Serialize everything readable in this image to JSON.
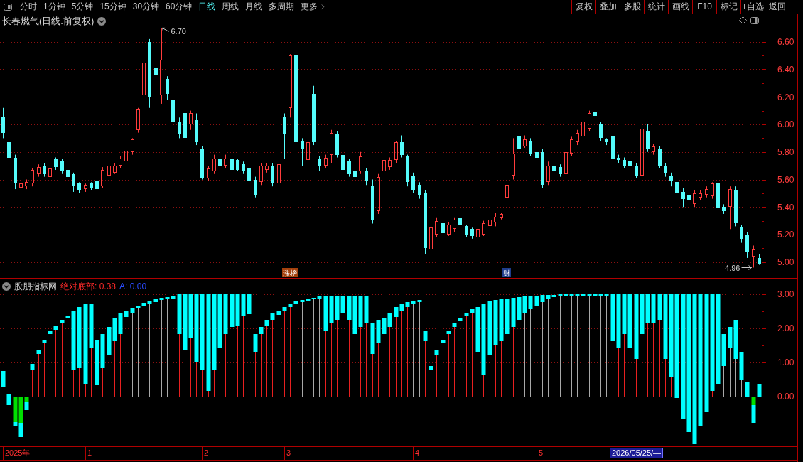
{
  "toolbar": {
    "tabs": [
      {
        "label": "分时",
        "selected": false
      },
      {
        "label": "1分钟",
        "selected": false
      },
      {
        "label": "5分钟",
        "selected": false
      },
      {
        "label": "15分钟",
        "selected": false
      },
      {
        "label": "30分钟",
        "selected": false
      },
      {
        "label": "60分钟",
        "selected": false
      },
      {
        "label": "日线",
        "selected": true
      },
      {
        "label": "周线",
        "selected": false
      },
      {
        "label": "月线",
        "selected": false
      },
      {
        "label": "多周期",
        "selected": false
      }
    ],
    "more": {
      "label": "更多"
    },
    "actions": [
      "复权",
      "叠加",
      "多股",
      "统计",
      "画线",
      "F10",
      "标记",
      "+自选",
      "返回"
    ]
  },
  "price_panel": {
    "title": "长春燃气(日线.前复权)",
    "high_mark": "6.70",
    "low_mark": "4.96",
    "events": [
      {
        "label": "涨榜",
        "kind": "rank"
      },
      {
        "label": "财",
        "kind": "finance"
      }
    ],
    "chart_data": [
      {
        "type": "candlestick",
        "ylim": [
          4.88,
          6.8
        ],
        "yticks": [
          {
            "value": 5.0,
            "label": "5.00"
          },
          {
            "value": 5.2,
            "label": "5.20"
          },
          {
            "value": 5.4,
            "label": "5.40"
          },
          {
            "value": 5.6,
            "label": "5.60"
          },
          {
            "value": 5.8,
            "label": "5.80"
          },
          {
            "value": 6.0,
            "label": "6.00"
          },
          {
            "value": 6.2,
            "label": "6.20"
          },
          {
            "value": 6.4,
            "label": "6.40"
          },
          {
            "value": 6.6,
            "label": "6.60"
          }
        ],
        "grid": true,
        "ohlc": [
          [
            6.05,
            6.12,
            5.9,
            5.94
          ],
          [
            5.87,
            5.9,
            5.74,
            5.76
          ],
          [
            5.76,
            5.78,
            5.53,
            5.57
          ],
          [
            5.54,
            5.6,
            5.5,
            5.57
          ],
          [
            5.55,
            5.6,
            5.53,
            5.58
          ],
          [
            5.57,
            5.68,
            5.55,
            5.67
          ],
          [
            5.64,
            5.71,
            5.62,
            5.69
          ],
          [
            5.7,
            5.72,
            5.62,
            5.64
          ],
          [
            5.62,
            5.7,
            5.61,
            5.68
          ],
          [
            5.75,
            5.76,
            5.67,
            5.69
          ],
          [
            5.73,
            5.75,
            5.64,
            5.66
          ],
          [
            5.67,
            5.68,
            5.6,
            5.62
          ],
          [
            5.64,
            5.65,
            5.51,
            5.55
          ],
          [
            5.57,
            5.58,
            5.5,
            5.52
          ],
          [
            5.53,
            5.57,
            5.51,
            5.56
          ],
          [
            5.57,
            5.58,
            5.52,
            5.54
          ],
          [
            5.59,
            5.61,
            5.5,
            5.53
          ],
          [
            5.55,
            5.69,
            5.54,
            5.67
          ],
          [
            5.63,
            5.71,
            5.62,
            5.7
          ],
          [
            5.65,
            5.72,
            5.64,
            5.7
          ],
          [
            5.7,
            5.77,
            5.68,
            5.75
          ],
          [
            5.73,
            5.82,
            5.71,
            5.81
          ],
          [
            5.8,
            5.9,
            5.78,
            5.89
          ],
          [
            5.96,
            6.12,
            5.94,
            6.11
          ],
          [
            6.21,
            6.47,
            6.18,
            6.45
          ],
          [
            6.6,
            6.62,
            6.12,
            6.2
          ],
          [
            6.41,
            6.43,
            6.33,
            6.36
          ],
          [
            6.21,
            6.7,
            6.15,
            6.47
          ],
          [
            6.33,
            6.35,
            6.18,
            6.22
          ],
          [
            6.18,
            6.2,
            6.0,
            6.02
          ],
          [
            6.02,
            6.05,
            5.9,
            5.93
          ],
          [
            6.08,
            6.1,
            5.88,
            5.9
          ],
          [
            6.0,
            6.1,
            5.96,
            6.08
          ],
          [
            6.03,
            6.08,
            5.85,
            5.87
          ],
          [
            5.82,
            5.84,
            5.6,
            5.61
          ],
          [
            5.61,
            5.7,
            5.59,
            5.68
          ],
          [
            5.66,
            5.78,
            5.64,
            5.75
          ],
          [
            5.75,
            5.76,
            5.68,
            5.7
          ],
          [
            5.7,
            5.78,
            5.68,
            5.75
          ],
          [
            5.75,
            5.76,
            5.65,
            5.67
          ],
          [
            5.74,
            5.75,
            5.66,
            5.67
          ],
          [
            5.71,
            5.73,
            5.64,
            5.66
          ],
          [
            5.68,
            5.7,
            5.57,
            5.59
          ],
          [
            5.6,
            5.62,
            5.47,
            5.49
          ],
          [
            5.58,
            5.72,
            5.56,
            5.7
          ],
          [
            5.67,
            5.72,
            5.65,
            5.7
          ],
          [
            5.7,
            5.72,
            5.55,
            5.57
          ],
          [
            5.57,
            5.73,
            5.56,
            5.71
          ],
          [
            6.05,
            6.08,
            5.75,
            5.93
          ],
          [
            6.12,
            6.51,
            6.05,
            6.5
          ],
          [
            6.5,
            6.51,
            5.85,
            5.87
          ],
          [
            5.88,
            5.9,
            5.7,
            5.82
          ],
          [
            5.74,
            5.88,
            5.62,
            5.87
          ],
          [
            6.22,
            6.28,
            5.85,
            5.87
          ],
          [
            5.75,
            5.77,
            5.66,
            5.7
          ],
          [
            5.7,
            5.78,
            5.68,
            5.76
          ],
          [
            5.78,
            5.96,
            5.72,
            5.94
          ],
          [
            5.93,
            5.95,
            5.76,
            5.78
          ],
          [
            5.78,
            5.8,
            5.65,
            5.67
          ],
          [
            5.73,
            5.75,
            5.62,
            5.64
          ],
          [
            5.66,
            5.68,
            5.58,
            5.62
          ],
          [
            5.66,
            5.8,
            5.64,
            5.77
          ],
          [
            5.66,
            5.68,
            5.56,
            5.59
          ],
          [
            5.55,
            5.6,
            5.28,
            5.31
          ],
          [
            5.37,
            5.64,
            5.35,
            5.62
          ],
          [
            5.66,
            5.76,
            5.55,
            5.74
          ],
          [
            5.69,
            5.76,
            5.67,
            5.74
          ],
          [
            5.74,
            5.88,
            5.72,
            5.87
          ],
          [
            5.87,
            5.92,
            5.76,
            5.78
          ],
          [
            5.77,
            5.78,
            5.55,
            5.58
          ],
          [
            5.63,
            5.65,
            5.5,
            5.52
          ],
          [
            5.56,
            5.58,
            5.46,
            5.49
          ],
          [
            5.5,
            5.52,
            5.06,
            5.1
          ],
          [
            5.09,
            5.28,
            5.03,
            5.25
          ],
          [
            5.2,
            5.32,
            5.18,
            5.3
          ],
          [
            5.28,
            5.3,
            5.19,
            5.21
          ],
          [
            5.2,
            5.29,
            5.19,
            5.27
          ],
          [
            5.24,
            5.32,
            5.22,
            5.31
          ],
          [
            5.32,
            5.34,
            5.25,
            5.27
          ],
          [
            5.26,
            5.27,
            5.18,
            5.2
          ],
          [
            5.24,
            5.25,
            5.17,
            5.19
          ],
          [
            5.18,
            5.26,
            5.17,
            5.24
          ],
          [
            5.2,
            5.3,
            5.19,
            5.28
          ],
          [
            5.26,
            5.33,
            5.25,
            5.31
          ],
          [
            5.29,
            5.36,
            5.26,
            5.33
          ],
          [
            5.32,
            5.36,
            5.31,
            5.35
          ],
          [
            5.47,
            5.58,
            5.46,
            5.56
          ],
          [
            5.63,
            5.9,
            5.6,
            5.79
          ],
          [
            5.91,
            5.93,
            5.8,
            5.82
          ],
          [
            5.84,
            5.92,
            5.83,
            5.89
          ],
          [
            5.88,
            5.9,
            5.77,
            5.79
          ],
          [
            5.8,
            5.82,
            5.74,
            5.76
          ],
          [
            5.8,
            5.82,
            5.54,
            5.56
          ],
          [
            5.58,
            5.73,
            5.56,
            5.7
          ],
          [
            5.7,
            5.72,
            5.65,
            5.66
          ],
          [
            5.69,
            5.71,
            5.62,
            5.64
          ],
          [
            5.64,
            5.82,
            5.63,
            5.8
          ],
          [
            5.79,
            5.91,
            5.77,
            5.89
          ],
          [
            5.87,
            5.96,
            5.85,
            5.94
          ],
          [
            5.91,
            6.04,
            5.89,
            6.02
          ],
          [
            5.97,
            6.1,
            5.95,
            6.08
          ],
          [
            6.09,
            6.32,
            6.04,
            6.06
          ],
          [
            6.0,
            6.02,
            5.88,
            5.9
          ],
          [
            5.89,
            5.9,
            5.85,
            5.87
          ],
          [
            5.91,
            5.93,
            5.72,
            5.75
          ],
          [
            5.76,
            5.78,
            5.72,
            5.74
          ],
          [
            5.74,
            5.76,
            5.68,
            5.7
          ],
          [
            5.73,
            5.75,
            5.68,
            5.7
          ],
          [
            5.7,
            5.72,
            5.61,
            5.63
          ],
          [
            5.63,
            6.02,
            5.6,
            5.97
          ],
          [
            5.95,
            6.0,
            5.8,
            5.82
          ],
          [
            5.8,
            5.86,
            5.78,
            5.84
          ],
          [
            5.82,
            5.84,
            5.68,
            5.7
          ],
          [
            5.7,
            5.72,
            5.62,
            5.65
          ],
          [
            5.63,
            5.65,
            5.55,
            5.59
          ],
          [
            5.58,
            5.6,
            5.46,
            5.5
          ],
          [
            5.51,
            5.54,
            5.4,
            5.46
          ],
          [
            5.49,
            5.52,
            5.4,
            5.45
          ],
          [
            5.42,
            5.52,
            5.4,
            5.5
          ],
          [
            5.47,
            5.52,
            5.45,
            5.5
          ],
          [
            5.49,
            5.55,
            5.47,
            5.53
          ],
          [
            5.48,
            5.58,
            5.46,
            5.57
          ],
          [
            5.57,
            5.6,
            5.37,
            5.39
          ],
          [
            5.4,
            5.42,
            5.35,
            5.37
          ],
          [
            5.4,
            5.55,
            5.24,
            5.53
          ],
          [
            5.52,
            5.55,
            5.26,
            5.28
          ],
          [
            5.25,
            5.27,
            5.14,
            5.17
          ],
          [
            5.2,
            5.22,
            5.03,
            5.07
          ],
          [
            5.04,
            5.12,
            4.96,
            5.09
          ],
          [
            5.03,
            5.06,
            4.98,
            4.99
          ]
        ]
      }
    ]
  },
  "indicator_panel": {
    "title": "股朋指标网",
    "readings": [
      {
        "label": "绝对底部: 0.38",
        "color": "#ff2a2a"
      },
      {
        "label": "A: 0.00",
        "color": "#2a4bff"
      }
    ],
    "chart_data": [
      {
        "type": "bar",
        "ylim": [
          -1.48,
          3.46
        ],
        "yticks": [
          {
            "value": 0,
            "label": "0.00"
          },
          {
            "value": 1,
            "label": "1.00"
          },
          {
            "value": 2,
            "label": "2.00"
          },
          {
            "value": 3,
            "label": "3.00"
          }
        ],
        "grid": true,
        "series": [
          {
            "type": "bar",
            "color": "#e82020",
            "values": [
              null,
              null,
              null,
              null,
              null,
              0.79,
              1.25,
              1.58,
              1.83,
              1.96,
              2.15,
              2.29,
              0.79,
              0.83,
              0.38,
              1.42,
              0.33,
              0.83,
              1.21,
              1.63,
              1.83,
              2.33,
              null,
              null,
              null,
              null,
              null,
              null,
              null,
              null,
              1.83,
              1.38,
              1.73,
              1.0,
              0.79,
              0.17,
              0.79,
              1.42,
              1.83,
              2.04,
              2.08,
              2.35,
              2.42,
              1.31,
              1.83,
              2.08,
              2.25,
              2.4,
              2.52,
              2.63,
              null,
              null,
              null,
              null,
              null,
              1.94,
              2.15,
              2.25,
              2.46,
              2.25,
              1.83,
              2.04,
              2.15,
              1.25,
              1.58,
              1.83,
              2.04,
              2.33,
              2.5,
              2.63,
              null,
              null,
              1.63,
              0.79,
              1.21,
              1.58,
              1.83,
              2.04,
              2.21,
              2.35,
              2.46,
              1.31,
              0.63,
              1.21,
              1.52,
              1.63,
              1.83,
              2.04,
              2.25,
              null,
              null,
              null,
              null,
              null,
              null,
              null,
              null,
              null,
              null,
              null,
              null,
              null,
              null,
              null,
              1.63,
              1.42,
              1.83,
              1.42,
              1.1,
              1.83,
              2.15,
              2.15,
              2.25,
              1.1,
              0.58,
              null,
              null,
              null,
              null,
              null,
              null,
              0.17,
              0.38,
              null,
              null,
              null,
              null,
              null,
              null,
              null
            ]
          },
          {
            "type": "bar",
            "color": "#a8a8a8",
            "values": [
              null,
              null,
              null,
              null,
              null,
              null,
              null,
              null,
              null,
              null,
              null,
              null,
              null,
              null,
              null,
              null,
              null,
              null,
              null,
              null,
              null,
              null,
              2.46,
              2.58,
              2.67,
              2.71,
              2.77,
              2.83,
              2.85,
              2.88,
              null,
              null,
              null,
              null,
              null,
              null,
              null,
              null,
              null,
              null,
              null,
              null,
              null,
              null,
              null,
              null,
              null,
              null,
              null,
              null,
              2.71,
              2.77,
              2.81,
              2.85,
              2.88,
              null,
              null,
              null,
              null,
              null,
              null,
              null,
              null,
              null,
              null,
              null,
              null,
              null,
              null,
              null,
              2.71,
              2.77,
              null,
              null,
              null,
              null,
              null,
              null,
              null,
              null,
              null,
              null,
              null,
              null,
              null,
              null,
              null,
              null,
              null,
              2.46,
              2.56,
              2.67,
              2.77,
              2.85,
              2.92,
              2.96,
              2.96,
              2.96,
              2.96,
              2.96,
              2.96,
              2.96,
              2.96,
              2.96,
              null,
              null,
              null,
              null,
              null,
              null,
              null,
              null,
              null,
              null,
              null,
              null,
              null,
              null,
              null,
              null,
              null,
              null,
              null,
              0.9,
              1.42,
              1.1,
              0.48,
              null,
              null,
              null
            ]
          },
          {
            "type": "bar",
            "color": "#00ffff",
            "base": [
              0.27,
              -0.25,
              -0.88,
              -1.19,
              -0.4,
              0.79,
              1.25,
              1.58,
              1.83,
              1.96,
              2.15,
              2.29,
              0.79,
              0.83,
              0.38,
              1.42,
              0.33,
              0.83,
              1.21,
              1.63,
              1.83,
              2.33,
              2.46,
              2.58,
              2.67,
              2.71,
              2.77,
              2.83,
              2.85,
              2.88,
              1.83,
              1.38,
              1.73,
              1.0,
              0.79,
              0.17,
              0.79,
              1.42,
              1.83,
              2.04,
              2.08,
              2.35,
              2.42,
              1.31,
              1.83,
              2.08,
              2.25,
              2.4,
              2.52,
              2.63,
              2.71,
              2.77,
              2.81,
              2.85,
              2.88,
              1.94,
              2.15,
              2.25,
              2.46,
              2.25,
              1.83,
              2.04,
              2.15,
              1.25,
              1.58,
              1.83,
              2.04,
              2.33,
              2.5,
              2.63,
              2.71,
              2.77,
              1.63,
              0.79,
              1.21,
              1.58,
              1.83,
              2.04,
              2.21,
              2.35,
              2.46,
              1.31,
              0.63,
              1.21,
              1.52,
              1.63,
              1.83,
              2.04,
              2.25,
              2.46,
              2.56,
              2.67,
              2.77,
              2.85,
              2.92,
              2.96,
              2.96,
              2.96,
              2.96,
              2.96,
              2.96,
              2.96,
              2.96,
              2.96,
              1.63,
              1.42,
              1.83,
              1.42,
              1.1,
              1.83,
              2.15,
              2.15,
              2.25,
              1.1,
              0.58,
              -0.04,
              -0.67,
              -1.04,
              -1.4,
              -0.88,
              -0.46,
              0.17,
              0.38,
              0.9,
              1.42,
              1.1,
              0.48,
              0.0,
              -0.77,
              0.0
            ],
            "values": [
              0.48,
              0.31,
              0.13,
              0.42,
              0.25,
              0.17,
              0.1,
              0.09,
              0.09,
              0.1,
              0.1,
              0.09,
              1.73,
              1.8,
              2.33,
              1.29,
              1.34,
              1.0,
              0.83,
              0.66,
              0.63,
              0.19,
              0.14,
              0.09,
              0.08,
              0.08,
              0.08,
              0.07,
              0.07,
              0.06,
              1.17,
              1.62,
              1.27,
              2.0,
              2.21,
              2.83,
              2.21,
              1.58,
              1.17,
              0.96,
              0.92,
              0.65,
              0.58,
              0.52,
              0.21,
              0.17,
              0.21,
              0.12,
              0.11,
              0.08,
              0.08,
              0.06,
              0.07,
              0.05,
              0.06,
              1.0,
              0.79,
              0.69,
              0.48,
              0.69,
              1.11,
              0.9,
              0.79,
              0.9,
              0.67,
              0.46,
              0.42,
              0.3,
              0.21,
              0.14,
              0.08,
              0.06,
              0.31,
              0.11,
              0.14,
              0.09,
              0.11,
              0.11,
              0.08,
              0.11,
              0.1,
              1.32,
              2.08,
              1.58,
              1.31,
              1.22,
              1.05,
              0.86,
              0.67,
              0.48,
              0.4,
              0.29,
              0.21,
              0.13,
              0.06,
              0.04,
              0.04,
              0.04,
              0.04,
              0.04,
              0.04,
              0.04,
              0.04,
              0.04,
              1.37,
              1.58,
              1.17,
              1.58,
              1.9,
              1.17,
              0.85,
              0.85,
              0.75,
              1.9,
              2.42,
              3.04,
              3.67,
              4.04,
              4.4,
              3.88,
              3.46,
              2.83,
              2.62,
              0.93,
              0.62,
              1.15,
              0.83,
              0.42,
              0.52,
              0.38
            ]
          },
          {
            "type": "bar",
            "color": "#00e000",
            "values": [
              null,
              null,
              -0.75,
              -0.77,
              -0.15,
              null,
              null,
              null,
              null,
              null,
              null,
              null,
              null,
              null,
              null,
              null,
              null,
              null,
              null,
              null,
              null,
              null,
              null,
              null,
              null,
              null,
              null,
              null,
              null,
              null,
              null,
              null,
              null,
              null,
              null,
              null,
              null,
              null,
              null,
              null,
              null,
              null,
              null,
              null,
              null,
              null,
              null,
              null,
              null,
              null,
              null,
              null,
              null,
              null,
              null,
              null,
              null,
              null,
              null,
              null,
              null,
              null,
              null,
              null,
              null,
              null,
              null,
              null,
              null,
              null,
              null,
              null,
              null,
              null,
              null,
              null,
              null,
              null,
              null,
              null,
              null,
              null,
              null,
              null,
              null,
              null,
              null,
              null,
              null,
              null,
              null,
              null,
              null,
              null,
              null,
              null,
              null,
              null,
              null,
              null,
              null,
              null,
              null,
              null,
              null,
              null,
              null,
              null,
              null,
              null,
              null,
              null,
              null,
              null,
              null,
              null,
              null,
              null,
              null,
              null,
              null,
              null,
              null,
              null,
              null,
              null,
              null,
              null,
              -0.25,
              null
            ]
          }
        ]
      }
    ]
  },
  "time_axis": {
    "labels": [
      "2025年",
      "1",
      "2",
      "3",
      "4",
      "5"
    ],
    "cursor": "2026/05/25/—"
  }
}
